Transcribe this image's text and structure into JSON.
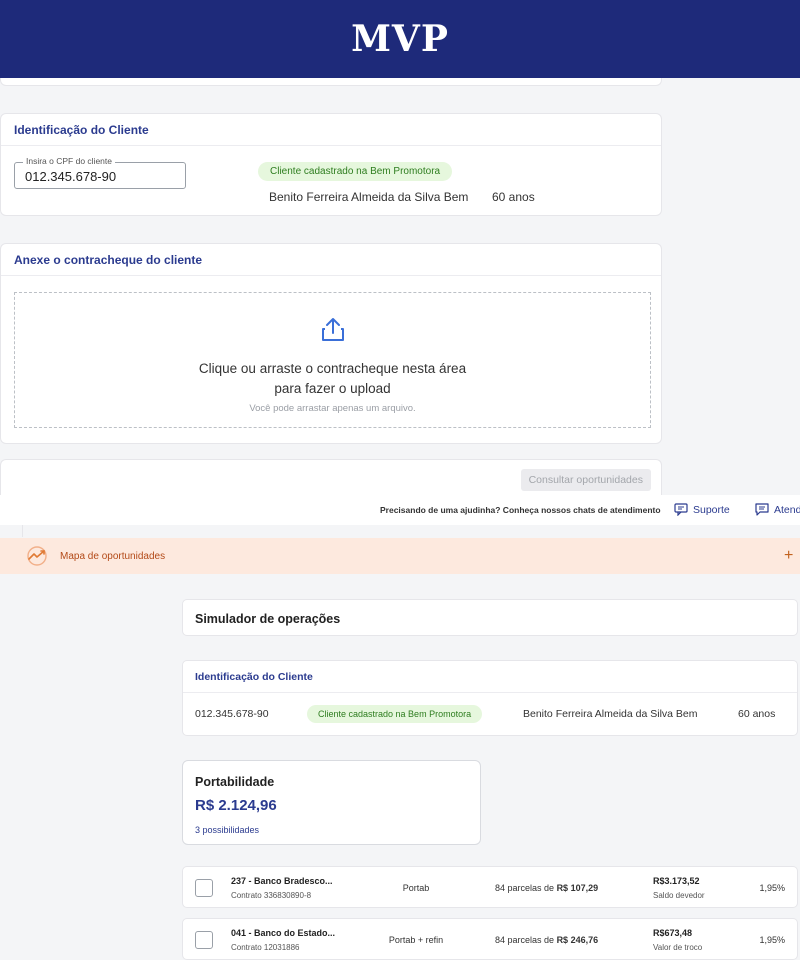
{
  "header": {
    "title": "MVP"
  },
  "client_id": {
    "title": "Identificação do Cliente",
    "cpf_label": "Insira o CPF do cliente",
    "cpf_value": "012.345.678-90",
    "badge": "Cliente cadastrado na Bem Promotora",
    "name": "Benito Ferreira Almeida da Silva Bem",
    "age": "60 anos"
  },
  "paycheck": {
    "title": "Anexe o contracheque do cliente",
    "upload_line1": "Clique ou arraste o contracheque nesta área",
    "upload_line2": "para fazer o upload",
    "upload_hint": "Você pode arrastar apenas um arquivo."
  },
  "actions": {
    "consult_label": "Consultar oportunidades"
  },
  "help": {
    "text": "Precisando de uma ajudinha? Conheça nossos chats de atendimento",
    "support_label": "Suporte",
    "atend_label": "Atend"
  },
  "opportunities": {
    "label": "Mapa de oportunidades",
    "expand": "+"
  },
  "simulator": {
    "title": "Simulador de operações",
    "client": {
      "title": "Identificação do Cliente",
      "cpf": "012.345.678-90",
      "badge": "Cliente cadastrado na Bem Promotora",
      "name": "Benito Ferreira Almeida da Silva Bem",
      "age": "60 anos"
    },
    "portability": {
      "title": "Portabilidade",
      "value": "R$ 2.124,96",
      "possibilities": "3 possibilidades"
    },
    "contracts": [
      {
        "bank": "237 - Banco Bradesco...",
        "contract": "Contrato 336830890-8",
        "type": "Portab",
        "installments_prefix": "84 parcelas de",
        "installment_value": "R$ 107,29",
        "amount": "R$3.173,52",
        "amount_label": "Saldo devedor",
        "rate": "1,95%"
      },
      {
        "bank": "041 - Banco do Estado...",
        "contract": "Contrato 12031886",
        "type": "Portab + refin",
        "installments_prefix": "84 parcelas de",
        "installment_value": "R$ 246,76",
        "amount": "R$673,48",
        "amount_label": "Valor de troco",
        "rate": "1,95%"
      }
    ]
  },
  "colors": {
    "header_bg": "#1e2a7a",
    "accent_blue": "#2b3b8f",
    "badge_green_bg": "#e6f7dd",
    "badge_green_text": "#2e7d1f",
    "opportunity_bg": "#fde9de",
    "opportunity_text": "#b34a18"
  }
}
